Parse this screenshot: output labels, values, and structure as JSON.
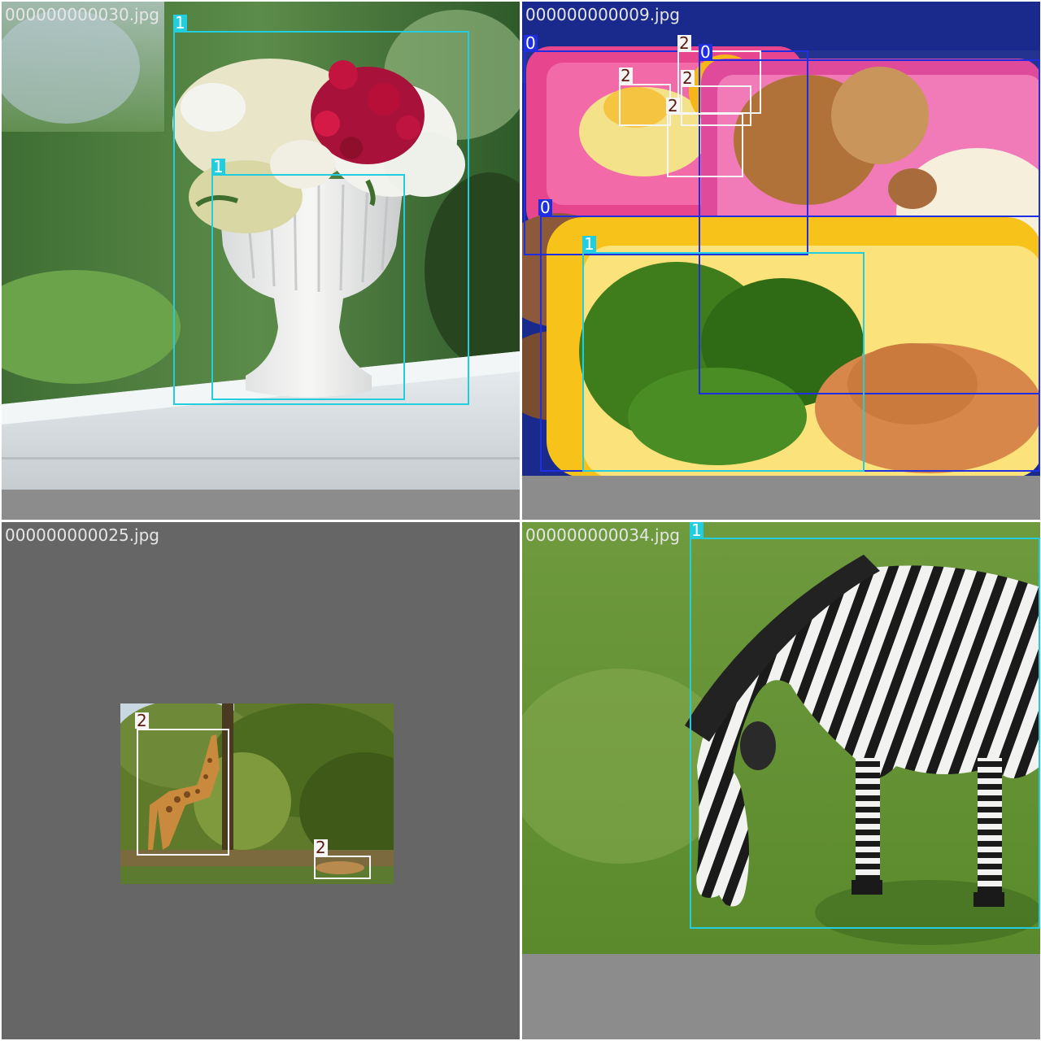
{
  "tiles": [
    {
      "id": "tl",
      "filename": "000000000030.jpg",
      "scene": "vase-of-flowers",
      "boxes": [
        {
          "class_label": "1",
          "color": "#23cde0"
        },
        {
          "class_label": "1",
          "color": "#23cde0"
        }
      ]
    },
    {
      "id": "tr",
      "filename": "000000000009.jpg",
      "scene": "lunch-boxes",
      "boxes": [
        {
          "class_label": "0",
          "color": "#1f2ee0"
        },
        {
          "class_label": "2",
          "color": "#f5f5f5"
        },
        {
          "class_label": "0",
          "color": "#1f2ee0"
        },
        {
          "class_label": "2",
          "color": "#f5f5f5"
        },
        {
          "class_label": "2",
          "color": "#f5f5f5"
        },
        {
          "class_label": "2",
          "color": "#f5f5f5"
        },
        {
          "class_label": "0",
          "color": "#1f2ee0"
        },
        {
          "class_label": "1",
          "color": "#23cde0"
        }
      ]
    },
    {
      "id": "bl",
      "filename": "000000000025.jpg",
      "scene": "giraffes",
      "boxes": [
        {
          "class_label": "2",
          "color": "#f5f5f5"
        },
        {
          "class_label": "2",
          "color": "#f5f5f5"
        }
      ]
    },
    {
      "id": "br",
      "filename": "000000000034.jpg",
      "scene": "zebra",
      "boxes": [
        {
          "class_label": "1",
          "color": "#23cde0"
        }
      ]
    }
  ]
}
